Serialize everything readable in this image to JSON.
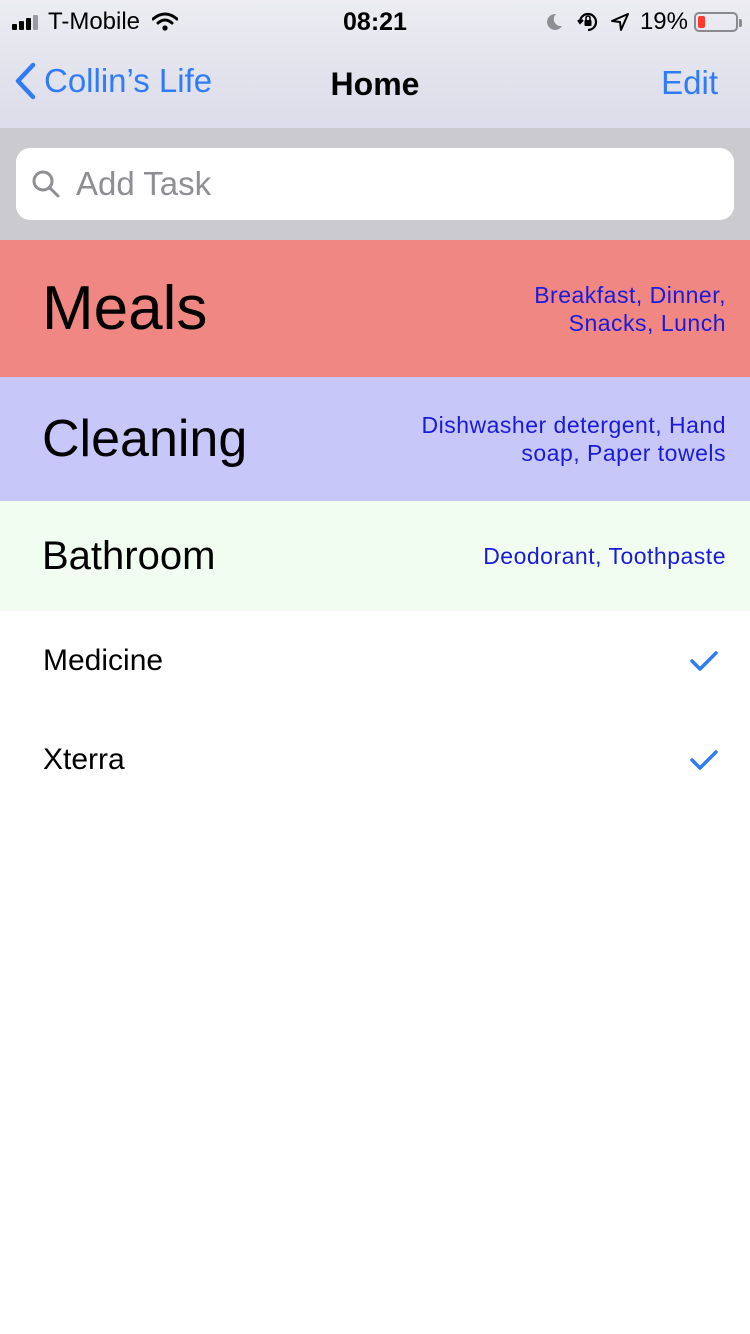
{
  "status_bar": {
    "carrier": "T-Mobile",
    "time": "08:21",
    "battery_percent": "19%",
    "battery_level": 0.19,
    "icons": [
      "signal-icon",
      "wifi-icon",
      "moon-icon",
      "rotation-lock-icon",
      "location-icon",
      "battery-icon"
    ]
  },
  "nav": {
    "back_label": "Collin’s Life",
    "title": "Home",
    "edit_label": "Edit"
  },
  "search": {
    "placeholder": "Add Task",
    "value": ""
  },
  "categories": [
    {
      "name": "Meals",
      "items": "Breakfast, Dinner, Snacks, Lunch",
      "color": "#f08783"
    },
    {
      "name": "Cleaning",
      "items": "Dishwasher detergent, Hand soap, Paper towels",
      "color": "#c7c7f9"
    },
    {
      "name": "Bathroom",
      "items": "Deodorant, Toothpaste",
      "color": "#f0fdf0"
    }
  ],
  "tasks": [
    {
      "label": "Medicine",
      "checked": true
    },
    {
      "label": "Xterra",
      "checked": true
    }
  ],
  "colors": {
    "accent": "#2f7cf6",
    "item_text": "#1a1adb"
  }
}
